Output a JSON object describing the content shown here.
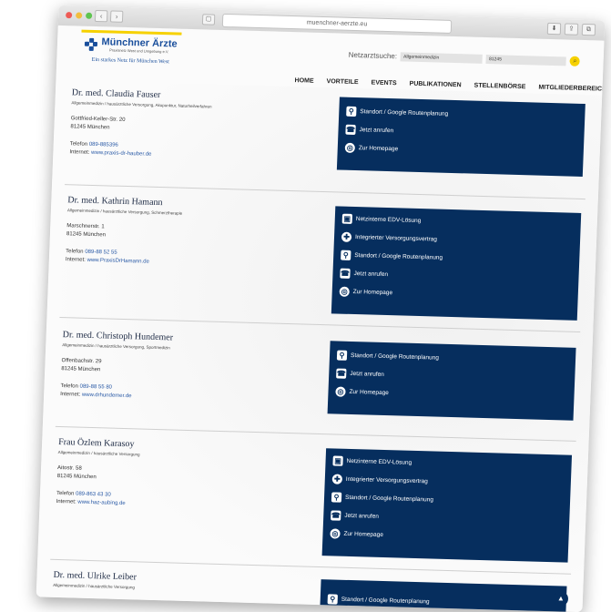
{
  "browser": {
    "url": "muenchner-aerzte.eu",
    "nav_back": "‹",
    "nav_forward": "›",
    "sidebar": "▢",
    "reload": "↻",
    "toolbar_icons": [
      "⬇",
      "⇪",
      "⧉"
    ],
    "new_tab": "+"
  },
  "site": {
    "logo_title": "Münchner Ärzte",
    "logo_sub": "Praxisnetz West und Umgebung e.V.",
    "logo_tagline": "Ein starkes Netz für München West",
    "search_label": "Netzarztsuche:",
    "search_specialty": "Allgemeinmedizin",
    "search_zip": "81245",
    "search_go": "⌕",
    "nav": [
      "HOME",
      "VORTEILE",
      "EVENTS",
      "PUBLIKATIONEN",
      "STELLENBÖRSE",
      "MITGLIEDERBEREICH"
    ]
  },
  "doctors": [
    {
      "name": "Dr. med. Claudia Fauser",
      "specialty": "Allgemeinmedizin / hausärztliche Versorgung, Akupunktur, Naturheilverfahren",
      "street": "Gottfried-Keller-Str. 20",
      "city": "81245 München",
      "phone_label": "Telefon",
      "phone": "089-885396",
      "web_label": "Internet:",
      "web": "www.praxis-dr-hauber.de",
      "services": [
        "Standort / Google Routenplanung",
        "Jetzt anrufen",
        "Zur Homepage"
      ]
    },
    {
      "name": "Dr. med. Kathrin Hamann",
      "specialty": "Allgemeinmedizin / hausärztliche Versorgung, Schmerztherapie",
      "street": "Marschnerstr. 1",
      "city": "81245 München",
      "phone_label": "Telefon",
      "phone": "089-88 52 55",
      "web_label": "Internet:",
      "web": "www.PraxisDrHamann.de",
      "services": [
        "Netzinterne EDV-Lösung",
        "Integrierter Versorgungsvertrag",
        "Standort / Google Routenplanung",
        "Jetzt anrufen",
        "Zur Homepage"
      ]
    },
    {
      "name": "Dr. med. Christoph Hundemer",
      "specialty": "Allgemeinmedizin / hausärztliche Versorgung, Sportmedizin",
      "street": "Offenbachstr. 29",
      "city": "81245 München",
      "phone_label": "Telefon",
      "phone": "089-88 55 80",
      "web_label": "Internet:",
      "web": "www.drhundemer.de",
      "services": [
        "Standort / Google Routenplanung",
        "Jetzt anrufen",
        "Zur Homepage"
      ]
    },
    {
      "name": "Frau Özlem Karasoy",
      "specialty": "Allgemeinmedizin / hausärztliche Versorgung",
      "street": "Aitostr. 58",
      "city": "81245 München",
      "phone_label": "Telefon",
      "phone": "089-863 43 30",
      "web_label": "Internet:",
      "web": "www.haz-aubing.de",
      "services": [
        "Netzinterne EDV-Lösung",
        "Integrierter Versorgungsvertrag",
        "Standort / Google Routenplanung",
        "Jetzt anrufen",
        "Zur Homepage"
      ]
    },
    {
      "name": "Dr. med. Ulrike Leiber",
      "specialty": "Allgemeinmedizin / hausärztliche Versorgung",
      "services": [
        "Standort / Google Routenplanung"
      ]
    }
  ],
  "service_icons": {
    "Netzinterne EDV-Lösung": "▣",
    "Integrierter Versorgungsvertrag": "✚",
    "Standort / Google Routenplanung": "⚲",
    "Jetzt anrufen": "☎",
    "Zur Homepage": "◎"
  },
  "scroll_top": "▲",
  "colors": {
    "panel": "#062e5e",
    "accent_yellow": "#f6d100",
    "link": "#2a5aa6"
  }
}
